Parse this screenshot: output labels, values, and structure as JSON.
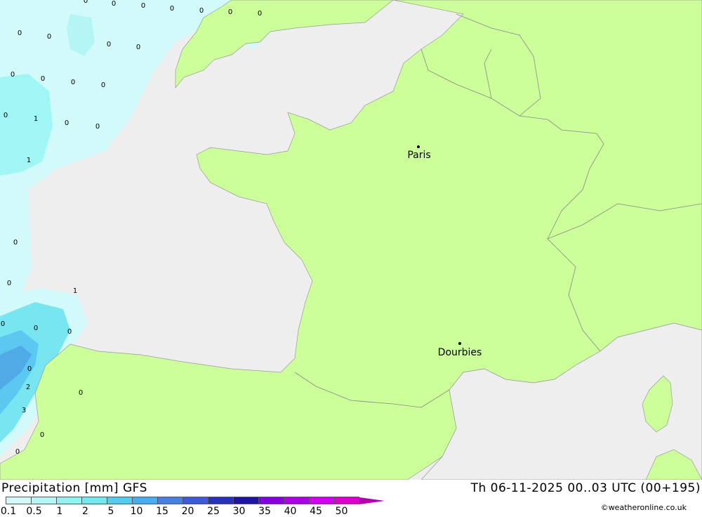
{
  "map": {
    "cities": [
      {
        "name": "Paris"
      },
      {
        "name": "Dourbies"
      }
    ],
    "precip_labels": [
      "0",
      "0",
      "0",
      "0",
      "0",
      "0",
      "0",
      "0",
      "0",
      "0",
      "0",
      "0",
      "0",
      "0",
      "0",
      "0",
      "0",
      "0",
      "1",
      "1",
      "0",
      "0",
      "1",
      "0",
      "0",
      "0",
      "0",
      "3",
      "0",
      "2",
      "0",
      "0"
    ]
  },
  "footer": {
    "title": "Precipitation [mm] GFS",
    "datetime": "Th 06-11-2025 00..03 UTC (00+195)",
    "credit": "©weatheronline.co.uk"
  },
  "legend": {
    "ticks": [
      "0.1",
      "0.5",
      "1",
      "2",
      "5",
      "10",
      "15",
      "20",
      "25",
      "30",
      "35",
      "40",
      "45",
      "50"
    ],
    "colors": [
      "#d2fafa",
      "#b4f5f5",
      "#96f0f0",
      "#78e6f0",
      "#5ac8f0",
      "#50aae6",
      "#4682dc",
      "#3c5ad2",
      "#2832b4",
      "#1e14a0",
      "#8200dc",
      "#aa00e6",
      "#d200f0",
      "#dc00c8",
      "#b000b0"
    ]
  }
}
